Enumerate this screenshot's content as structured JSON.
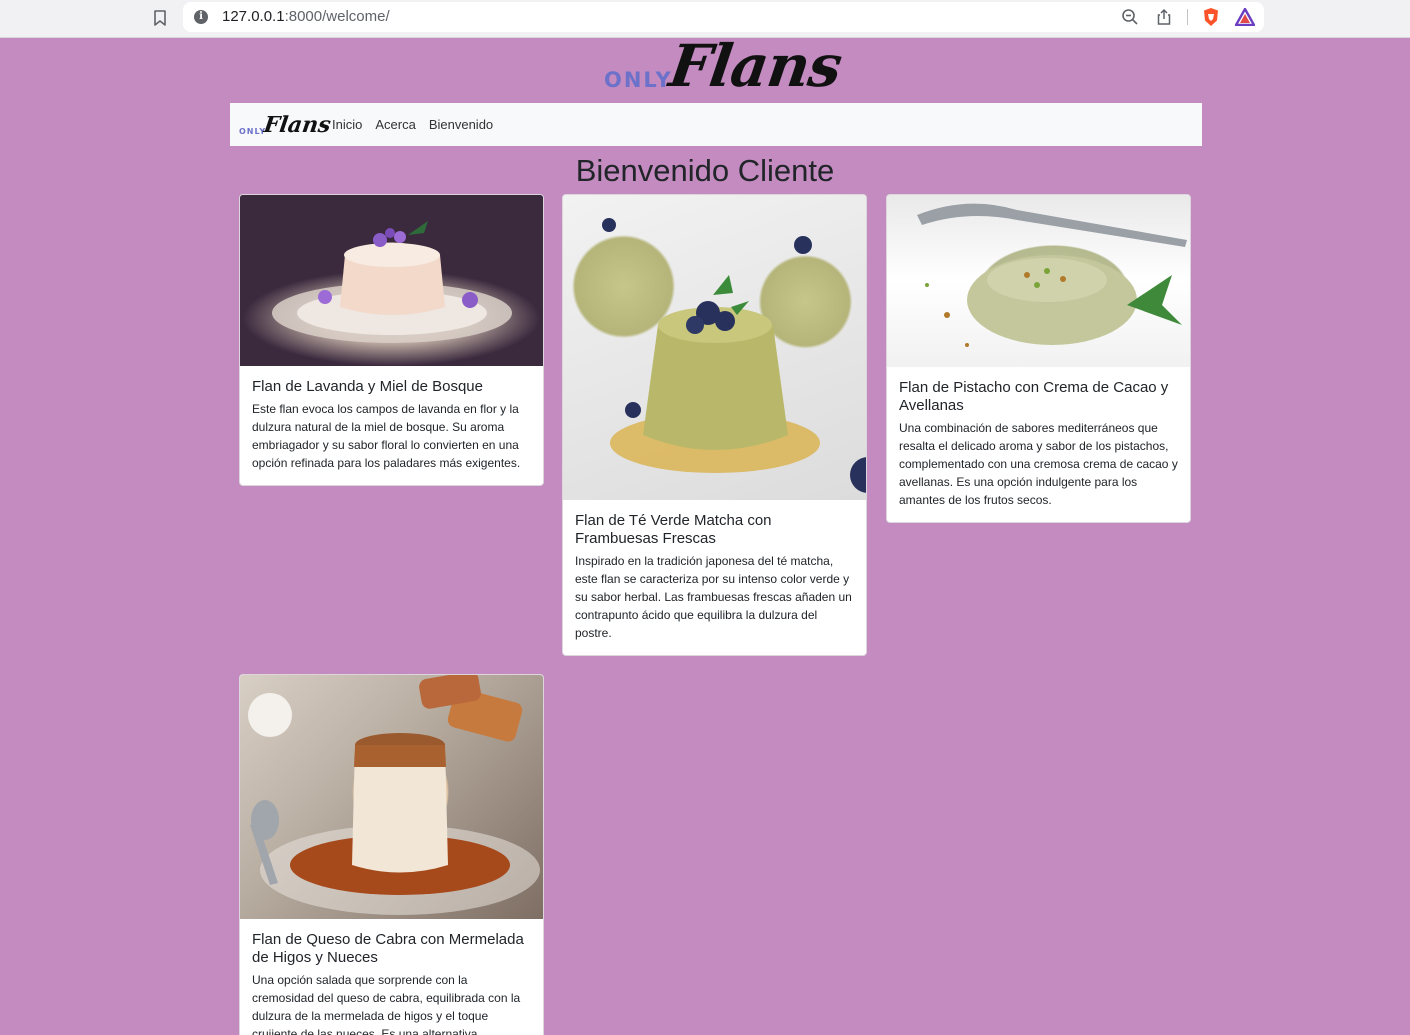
{
  "browser": {
    "url_host": "127.0.0.1",
    "url_rest": ":8000/welcome/"
  },
  "brand": {
    "only": "ONLY",
    "flans": "Flans"
  },
  "nav": {
    "items": [
      {
        "label": "Inicio"
      },
      {
        "label": "Acerca"
      },
      {
        "label": "Bienvenido"
      }
    ]
  },
  "page": {
    "title": "Bienvenido Cliente"
  },
  "cards": [
    {
      "title": "Flan de Lavanda y Miel de Bosque",
      "text": "Este flan evoca los campos de lavanda en flor y la dulzura natural de la miel de bosque. Su aroma embriagador y su sabor floral lo convierten en una opción refinada para los paladares más exigentes."
    },
    {
      "title": "Flan de Té Verde Matcha con Frambuesas Frescas",
      "text": "Inspirado en la tradición japonesa del té matcha, este flan se caracteriza por su intenso color verde y su sabor herbal. Las frambuesas frescas añaden un contrapunto ácido que equilibra la dulzura del postre."
    },
    {
      "title": "Flan de Pistacho con Crema de Cacao y Avellanas",
      "text": "Una combinación de sabores mediterráneos que resalta el delicado aroma y sabor de los pistachos, complementado con una cremosa crema de cacao y avellanas. Es una opción indulgente para los amantes de los frutos secos."
    },
    {
      "title": "Flan de Queso de Cabra con Mermelada de Higos y Nueces",
      "text": "Una opción salada que sorprende con la cremosidad del queso de cabra, equilibrada con la dulzura de la mermelada de higos y el toque crujiente de las nueces. Es una alternativa"
    }
  ]
}
